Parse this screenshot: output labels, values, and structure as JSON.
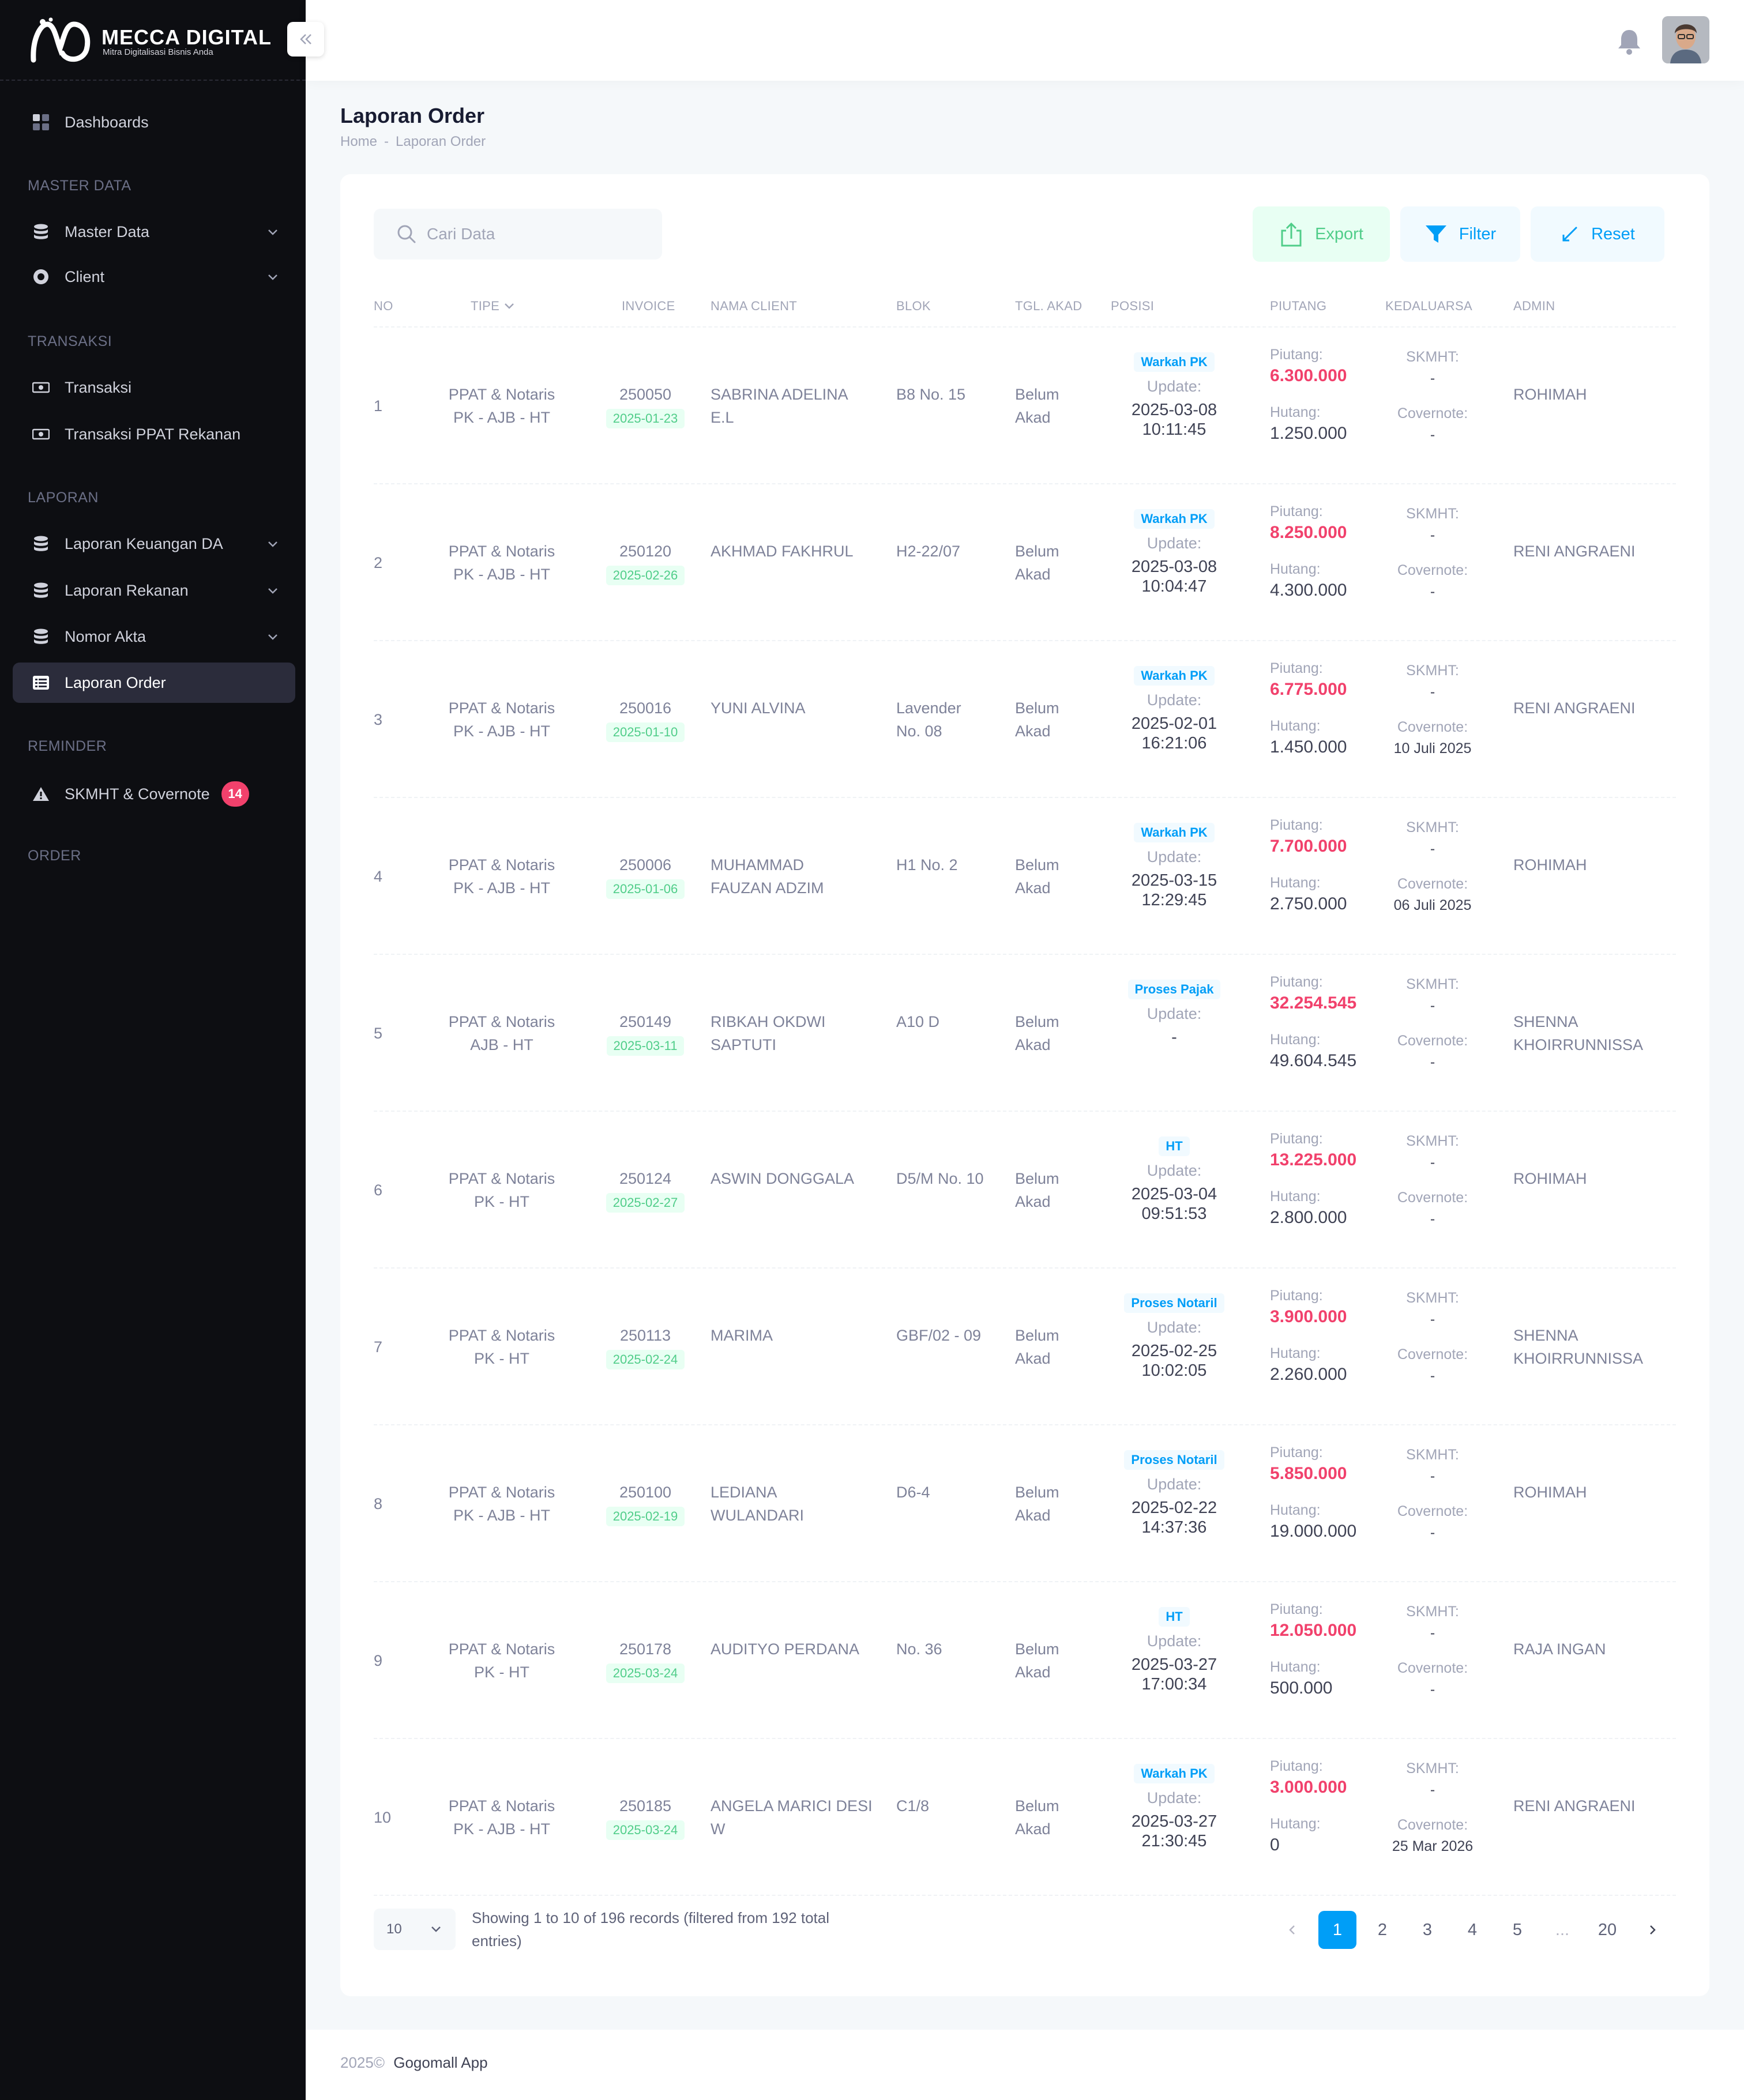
{
  "brand": {
    "name": "MECCA DIGITAL",
    "tagline": "Mitra Digitalisasi Bisnis Anda"
  },
  "sidebar": {
    "items": [
      {
        "label": "Dashboards"
      },
      {
        "section": "MASTER DATA"
      },
      {
        "label": "Master Data"
      },
      {
        "label": "Client"
      },
      {
        "section": "TRANSAKSI"
      },
      {
        "label": "Transaksi"
      },
      {
        "label": "Transaksi PPAT Rekanan"
      },
      {
        "section": "LAPORAN"
      },
      {
        "label": "Laporan Keuangan DA"
      },
      {
        "label": "Laporan Rekanan"
      },
      {
        "label": "Nomor Akta"
      },
      {
        "label": "Laporan Order"
      },
      {
        "section": "REMINDER"
      },
      {
        "label": "SKMHT & Covernote",
        "badge": "14"
      },
      {
        "section": "ORDER"
      }
    ]
  },
  "page": {
    "title": "Laporan Order",
    "breadcrumb": [
      "Home",
      "Laporan Order"
    ]
  },
  "toolbar": {
    "search_placeholder": "Cari Data",
    "export_label": "Export",
    "filter_label": "Filter",
    "reset_label": "Reset"
  },
  "table": {
    "columns": [
      "NO",
      "TIPE",
      "INVOICE",
      "NAMA CLIENT",
      "BLOK",
      "TGL. AKAD",
      "POSISI",
      "PIUTANG",
      "KEDALUARSA",
      "ADMIN"
    ],
    "labels": {
      "update": "Update:",
      "piutang": "Piutang:",
      "hutang": "Hutang:",
      "skmht": "SKMHT:",
      "covernote": "Covernote:"
    },
    "rows": [
      {
        "no": "1",
        "tipe1": "PPAT & Notaris",
        "tipe2": "PK - AJB - HT",
        "invoice": "250050",
        "inv_date": "2025-01-23",
        "client1": "SABRINA ADELINA",
        "client2": "E.L",
        "blok1": "B8 No. 15",
        "blok2": "",
        "akad1": "Belum",
        "akad2": "Akad",
        "posisi": "Warkah PK",
        "upd1": "2025-03-08",
        "upd2": "10:11:45",
        "piutang": "6.300.000",
        "hutang": "1.250.000",
        "skmht": "-",
        "covernote": "-",
        "admin1": "ROHIMAH",
        "admin2": ""
      },
      {
        "no": "2",
        "tipe1": "PPAT & Notaris",
        "tipe2": "PK - AJB - HT",
        "invoice": "250120",
        "inv_date": "2025-02-26",
        "client1": "AKHMAD FAKHRUL",
        "client2": "",
        "blok1": "H2-22/07",
        "blok2": "",
        "akad1": "Belum",
        "akad2": "Akad",
        "posisi": "Warkah PK",
        "upd1": "2025-03-08",
        "upd2": "10:04:47",
        "piutang": "8.250.000",
        "hutang": "4.300.000",
        "skmht": "-",
        "covernote": "-",
        "admin1": "RENI ANGRAENI",
        "admin2": ""
      },
      {
        "no": "3",
        "tipe1": "PPAT & Notaris",
        "tipe2": "PK - AJB - HT",
        "invoice": "250016",
        "inv_date": "2025-01-10",
        "client1": "YUNI ALVINA",
        "client2": "",
        "blok1": "Lavender",
        "blok2": "No. 08",
        "akad1": "Belum",
        "akad2": "Akad",
        "posisi": "Warkah PK",
        "upd1": "2025-02-01",
        "upd2": "16:21:06",
        "piutang": "6.775.000",
        "hutang": "1.450.000",
        "skmht": "-",
        "covernote": "10 Juli 2025",
        "admin1": "RENI ANGRAENI",
        "admin2": ""
      },
      {
        "no": "4",
        "tipe1": "PPAT & Notaris",
        "tipe2": "PK - AJB - HT",
        "invoice": "250006",
        "inv_date": "2025-01-06",
        "client1": "MUHAMMAD",
        "client2": "FAUZAN ADZIM",
        "blok1": "H1 No. 2",
        "blok2": "",
        "akad1": "Belum",
        "akad2": "Akad",
        "posisi": "Warkah PK",
        "upd1": "2025-03-15",
        "upd2": "12:29:45",
        "piutang": "7.700.000",
        "hutang": "2.750.000",
        "skmht": "-",
        "covernote": "06 Juli 2025",
        "admin1": "ROHIMAH",
        "admin2": ""
      },
      {
        "no": "5",
        "tipe1": "PPAT & Notaris",
        "tipe2": "AJB - HT",
        "invoice": "250149",
        "inv_date": "2025-03-11",
        "client1": "RIBKAH OKDWI",
        "client2": "SAPTUTI",
        "blok1": "A10 D",
        "blok2": "",
        "akad1": "Belum",
        "akad2": "Akad",
        "posisi": "Proses Pajak",
        "upd1": "-",
        "upd2": "",
        "piutang": "32.254.545",
        "hutang": "49.604.545",
        "skmht": "-",
        "covernote": "-",
        "admin1": "SHENNA",
        "admin2": "KHOIRRUNNISSA"
      },
      {
        "no": "6",
        "tipe1": "PPAT & Notaris",
        "tipe2": "PK - HT",
        "invoice": "250124",
        "inv_date": "2025-02-27",
        "client1": "ASWIN DONGGALA",
        "client2": "",
        "blok1": "D5/M No. 10",
        "blok2": "",
        "akad1": "Belum",
        "akad2": "Akad",
        "posisi": "HT",
        "upd1": "2025-03-04",
        "upd2": "09:51:53",
        "piutang": "13.225.000",
        "hutang": "2.800.000",
        "skmht": "-",
        "covernote": "-",
        "admin1": "ROHIMAH",
        "admin2": ""
      },
      {
        "no": "7",
        "tipe1": "PPAT & Notaris",
        "tipe2": "PK - HT",
        "invoice": "250113",
        "inv_date": "2025-02-24",
        "client1": "MARIMA",
        "client2": "",
        "blok1": "GBF/02 - 09",
        "blok2": "",
        "akad1": "Belum",
        "akad2": "Akad",
        "posisi": "Proses Notaril",
        "upd1": "2025-02-25",
        "upd2": "10:02:05",
        "piutang": "3.900.000",
        "hutang": "2.260.000",
        "skmht": "-",
        "covernote": "-",
        "admin1": "SHENNA",
        "admin2": "KHOIRRUNNISSA"
      },
      {
        "no": "8",
        "tipe1": "PPAT & Notaris",
        "tipe2": "PK - AJB - HT",
        "invoice": "250100",
        "inv_date": "2025-02-19",
        "client1": "LEDIANA",
        "client2": "WULANDARI",
        "blok1": "D6-4",
        "blok2": "",
        "akad1": "Belum",
        "akad2": "Akad",
        "posisi": "Proses Notaril",
        "upd1": "2025-02-22",
        "upd2": "14:37:36",
        "piutang": "5.850.000",
        "hutang": "19.000.000",
        "skmht": "-",
        "covernote": "-",
        "admin1": "ROHIMAH",
        "admin2": ""
      },
      {
        "no": "9",
        "tipe1": "PPAT & Notaris",
        "tipe2": "PK - HT",
        "invoice": "250178",
        "inv_date": "2025-03-24",
        "client1": "AUDITYO PERDANA",
        "client2": "",
        "blok1": "No. 36",
        "blok2": "",
        "akad1": "Belum",
        "akad2": "Akad",
        "posisi": "HT",
        "upd1": "2025-03-27",
        "upd2": "17:00:34",
        "piutang": "12.050.000",
        "hutang": "500.000",
        "skmht": "-",
        "covernote": "-",
        "admin1": "RAJA INGAN",
        "admin2": ""
      },
      {
        "no": "10",
        "tipe1": "PPAT & Notaris",
        "tipe2": "PK - AJB - HT",
        "invoice": "250185",
        "inv_date": "2025-03-24",
        "client1": "ANGELA MARICI DESI",
        "client2": "W",
        "blok1": "C1/8",
        "blok2": "",
        "akad1": "Belum",
        "akad2": "Akad",
        "posisi": "Warkah PK",
        "upd1": "2025-03-27",
        "upd2": "21:30:45",
        "piutang": "3.000.000",
        "hutang": "0",
        "skmht": "-",
        "covernote": "25 Mar 2026",
        "admin1": "RENI ANGRAENI",
        "admin2": ""
      }
    ]
  },
  "pagination": {
    "per_page": "10",
    "showing_line1": "Showing 1 to 10 of 196 records (filtered from 192 total",
    "showing_line2": "entries)",
    "pages": [
      "1",
      "2",
      "3",
      "4",
      "5",
      "...",
      "20"
    ],
    "active": "1"
  },
  "footer": {
    "year": "2025©",
    "app": "Gogomall App"
  },
  "colors": {
    "primary": "#009ef7",
    "success": "#50cd89",
    "danger": "#f1416c",
    "sidebar_bg": "#0d0e12"
  }
}
